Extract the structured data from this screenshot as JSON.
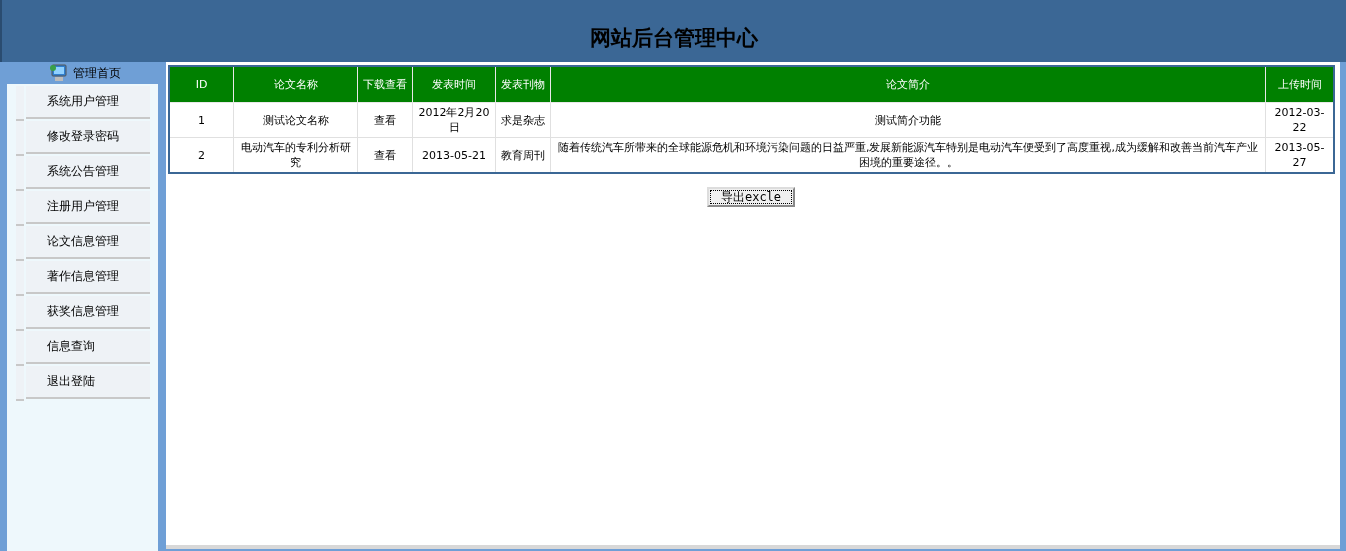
{
  "header": {
    "title": "网站后台管理中心"
  },
  "sidebar": {
    "home": "管理首页",
    "items": [
      {
        "label": "系统用户管理"
      },
      {
        "label": "修改登录密码"
      },
      {
        "label": "系统公告管理"
      },
      {
        "label": "注册用户管理"
      },
      {
        "label": "论文信息管理"
      },
      {
        "label": "著作信息管理"
      },
      {
        "label": "获奖信息管理"
      },
      {
        "label": "信息查询"
      },
      {
        "label": "退出登陆"
      }
    ]
  },
  "table": {
    "columns": [
      "ID",
      "论文名称",
      "下载查看",
      "发表时间",
      "发表刊物",
      "论文简介",
      "上传时间"
    ],
    "rows": [
      {
        "id": "1",
        "title": "测试论文名称",
        "action": "查看",
        "date": "2012年2月20日",
        "journal": "求是杂志",
        "summary": "测试简介功能",
        "uploaded": "2012-03-22"
      },
      {
        "id": "2",
        "title": "电动汽车的专利分析研究",
        "action": "查看",
        "date": "2013-05-21",
        "journal": "教育周刊",
        "summary": "随着传统汽车所带来的全球能源危机和环境污染问题的日益严重,发展新能源汽车特别是电动汽车便受到了高度重视,成为缓解和改善当前汽车产业困境的重要途径。。",
        "uploaded": "2013-05-27"
      }
    ]
  },
  "export_button": "导出excle"
}
